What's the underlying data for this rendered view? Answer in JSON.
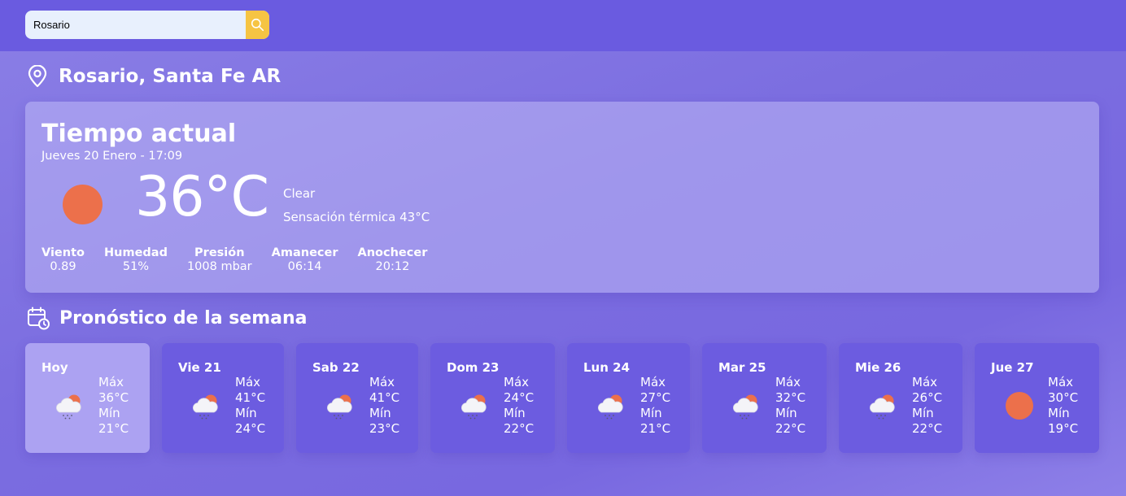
{
  "search": {
    "value": "Rosario",
    "button_icon": "search-icon"
  },
  "location": {
    "icon": "map-pin-icon",
    "name": "Rosario, Santa Fe AR"
  },
  "current": {
    "title": "Tiempo actual",
    "datetime": "Jueves 20 Enero - 17:09",
    "icon": "sun-icon",
    "temperature": "36°C",
    "condition": "Clear",
    "feels_like": "Sensación térmica 43°C",
    "stats": [
      {
        "label": "Viento",
        "value": "0.89"
      },
      {
        "label": "Humedad",
        "value": "51%"
      },
      {
        "label": "Presión",
        "value": "1008 mbar"
      },
      {
        "label": "Amanecer",
        "value": "06:14"
      },
      {
        "label": "Anochecer",
        "value": "20:12"
      }
    ]
  },
  "forecast": {
    "icon": "calendar-clock-icon",
    "title": "Pronóstico de la semana",
    "max_label": "Máx",
    "min_label": "Mín",
    "days": [
      {
        "day": "Hoy",
        "icon": "rain-cloud-sun-icon",
        "max": "36°C",
        "min": "21°C"
      },
      {
        "day": "Vie 21",
        "icon": "rain-cloud-sun-icon",
        "max": "41°C",
        "min": "24°C"
      },
      {
        "day": "Sab 22",
        "icon": "rain-cloud-sun-icon",
        "max": "41°C",
        "min": "23°C"
      },
      {
        "day": "Dom 23",
        "icon": "rain-cloud-sun-icon",
        "max": "24°C",
        "min": "22°C"
      },
      {
        "day": "Lun 24",
        "icon": "rain-cloud-sun-icon",
        "max": "27°C",
        "min": "21°C"
      },
      {
        "day": "Mar 25",
        "icon": "rain-cloud-sun-icon",
        "max": "32°C",
        "min": "22°C"
      },
      {
        "day": "Mie 26",
        "icon": "rain-cloud-sun-icon",
        "max": "26°C",
        "min": "22°C"
      },
      {
        "day": "Jue 27",
        "icon": "sun-icon",
        "max": "30°C",
        "min": "19°C"
      }
    ]
  },
  "colors": {
    "header_bg": "#6a5be0",
    "search_button": "#f6c443",
    "sun": "#ec704b",
    "card_bg": "#6c5ce0",
    "card_today_bg": "#aca2f2"
  }
}
